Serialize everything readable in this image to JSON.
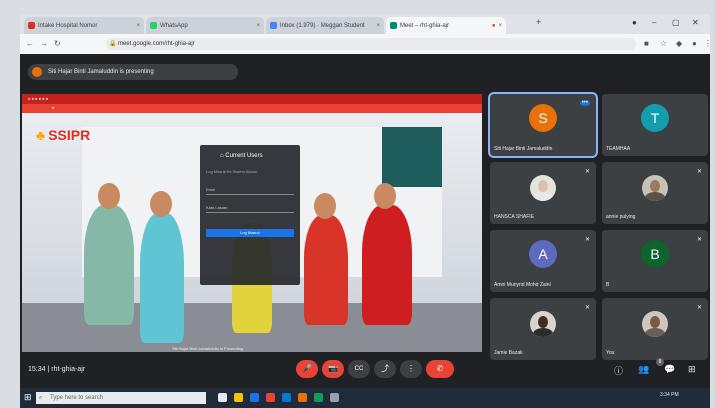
{
  "browser": {
    "tabs": [
      {
        "label": "Intake Hospital Nomor",
        "active": false,
        "color": "#d93025"
      },
      {
        "label": "WhatsApp",
        "active": false,
        "color": "#25d366"
      },
      {
        "label": "Inbox (1.979) · Meggan Student",
        "active": false,
        "color": "#4285f4"
      },
      {
        "label": "Meet – rht-ghia-ajr",
        "active": true,
        "color": "#00897b"
      }
    ],
    "new_tab": "+",
    "url": "meet.google.com/rht-ghia-ajr"
  },
  "meet": {
    "presenting_banner": "Siti Hajar Binti Jamaluddin is presenting",
    "meeting_code": "rht-ghia-ajr",
    "time": "15:34",
    "participants": [
      {
        "name": "Siti Hajar Binti Jamaluddin",
        "initial": "S",
        "color": "#e8710a",
        "speaking": true
      },
      {
        "name": "TEAMHAA",
        "initial": "T",
        "color": "#129eaf"
      },
      {
        "name": "HANSCA SHAFIE",
        "photo": true
      },
      {
        "name": "annie pulying",
        "photo": true
      },
      {
        "name": "Amni Munyrid Mohd Zaini",
        "initial": "A",
        "color": "#5c6bc0"
      },
      {
        "name": "B",
        "initial": "B",
        "color": "#0d652d"
      },
      {
        "name": "Jamie Bazak",
        "photo": true
      },
      {
        "name": "You",
        "photo": true
      }
    ],
    "controls": {
      "mic": "🎤",
      "camera": "📷",
      "captions": "CC",
      "present": "⤴",
      "more": "⋮",
      "end": "✆",
      "info": "ⓘ",
      "people": "👥",
      "people_count": "8",
      "chat": "💬",
      "activities": "⊞"
    }
  },
  "shared_screen": {
    "logo": "SSIPR",
    "login_title": "Current Users",
    "login_subtitle": "Log Masuk Ke Sistem Akaun",
    "field_email": "Emel",
    "field_password": "Kata Laluan",
    "login_button": "Log Masuk",
    "caption": "Siti Hajar Binti Jamaluddin Is Presenting"
  },
  "taskbar": {
    "search_placeholder": "Type here to search",
    "clock": "3:34 PM"
  }
}
